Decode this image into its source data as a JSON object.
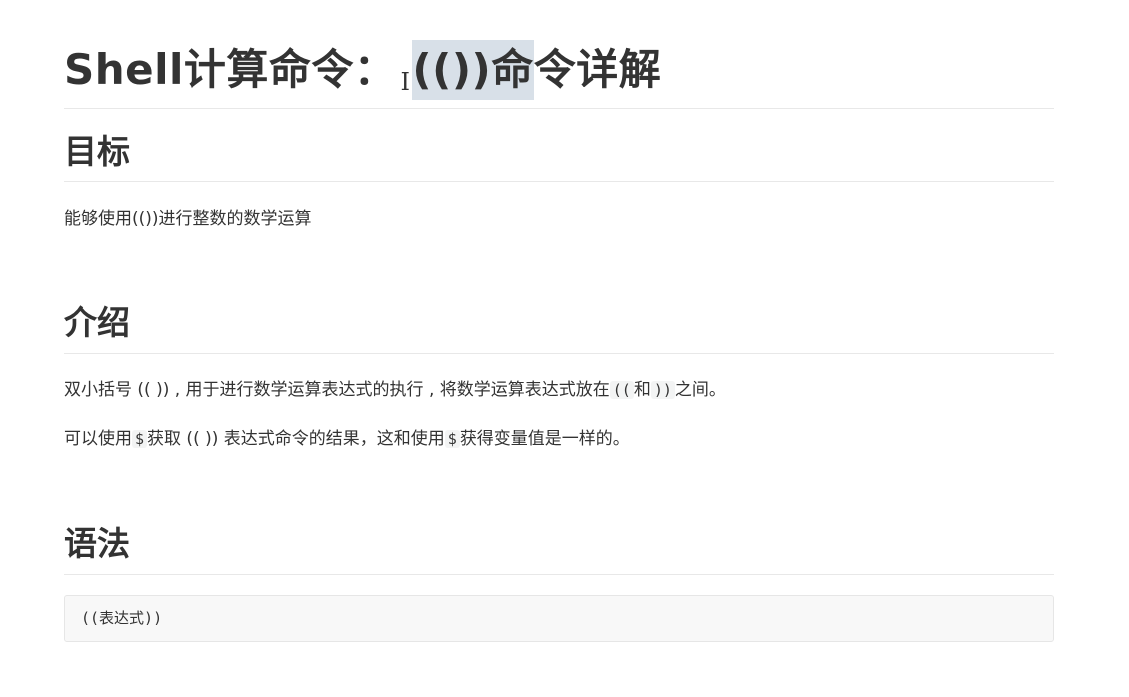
{
  "title": {
    "prefix": "Shell计算命令：",
    "selected": "(())命",
    "suffix": "令详解"
  },
  "sections": [
    {
      "heading": "目标",
      "lines": [
        "能够使用(())进行整数的数学运算"
      ]
    },
    {
      "heading": "介绍",
      "line1": {
        "text_a": "双小括号 (( )) , 用于进行数学运算表达式的执行 , 将数学运算表达式放在",
        "code_a": "((",
        "text_b": "和",
        "code_b": "))",
        "text_c": "之间。"
      },
      "line2": {
        "text_a": "可以使用",
        "code_a": "$",
        "text_b": "获取 (( )) 表达式命令的结果，这和使用",
        "code_b": "$",
        "text_c": "获得变量值是一样的。"
      }
    },
    {
      "heading": "语法",
      "code": "((表达式))"
    }
  ],
  "caret_glyph": "I"
}
